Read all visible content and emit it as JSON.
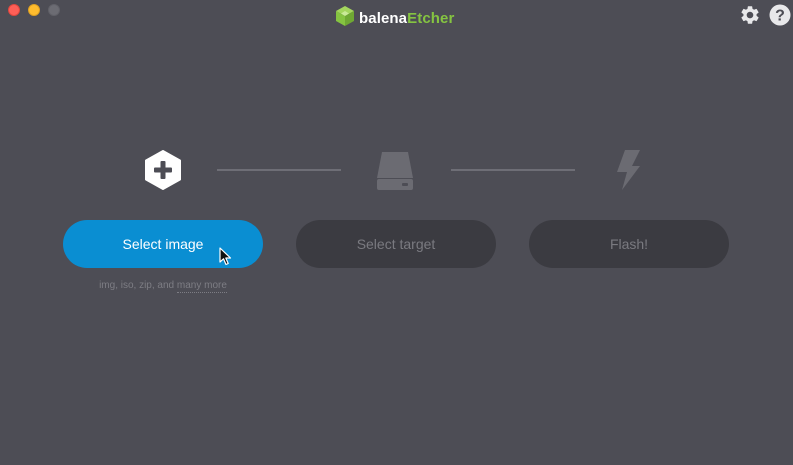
{
  "titlebar": {
    "brand_part1": "balena",
    "brand_part2": "Etcher",
    "brand_color": "#85c441",
    "icons": [
      "settings-gear-icon",
      "help-icon"
    ]
  },
  "steps": {
    "select_image": {
      "icon": "plus-hexagon-icon",
      "button_label": "Select image",
      "button_color": "#0a8ed2",
      "hint_prefix": "img, iso, zip, and",
      "hint_link": "many more"
    },
    "select_target": {
      "icon": "drive-icon",
      "button_label": "Select target"
    },
    "flash": {
      "icon": "lightning-bolt-icon",
      "button_label": "Flash!"
    }
  },
  "colors": {
    "background": "#4d4d55",
    "disabled_button": "#3b3b41",
    "disabled_text": "#7a7a80"
  }
}
